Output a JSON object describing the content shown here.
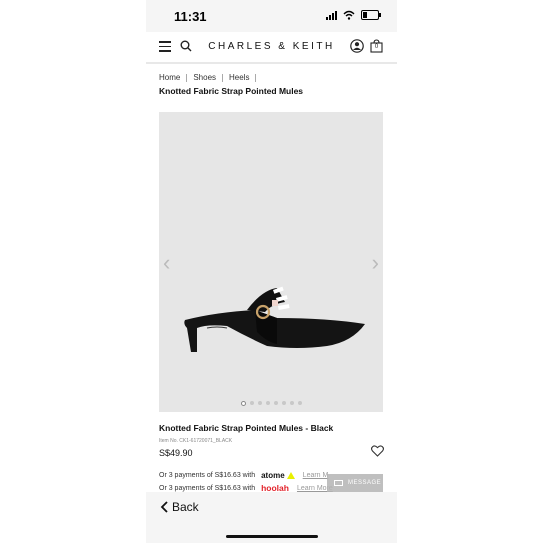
{
  "status_bar": {
    "time": "11:31"
  },
  "header": {
    "brand": "CHARLES & KEITH",
    "cart_count": "0"
  },
  "breadcrumb": {
    "items": [
      "Home",
      "Shoes",
      "Heels"
    ]
  },
  "page_title": "Knotted Fabric Strap Pointed Mules",
  "gallery": {
    "total_images": 8,
    "active_index": 0,
    "background": "#e6e6e6"
  },
  "product": {
    "name": "Knotted Fabric Strap Pointed Mules - Black",
    "item_no": "Item No. CK1-61720071_BLACK",
    "price": "S$49.90"
  },
  "payments": [
    {
      "text": "Or 3 payments of S$16.63 with",
      "provider": "atome",
      "learn": "Learn M"
    },
    {
      "text": "Or 3 payments of S$16.63 with",
      "provider": "hoolah",
      "learn": "Learn More"
    }
  ],
  "message_button": {
    "label": "MESSAGE"
  },
  "footer": {
    "back_label": "Back"
  },
  "colors": {
    "hoolah": "#e3232b",
    "atome": "#e8f000",
    "accent": "#111111"
  },
  "icons": [
    "menu-icon",
    "search-icon",
    "user-icon",
    "bag-icon",
    "chevron-left-icon",
    "chevron-right-icon",
    "heart-icon",
    "mail-icon",
    "back-chevron-icon"
  ]
}
